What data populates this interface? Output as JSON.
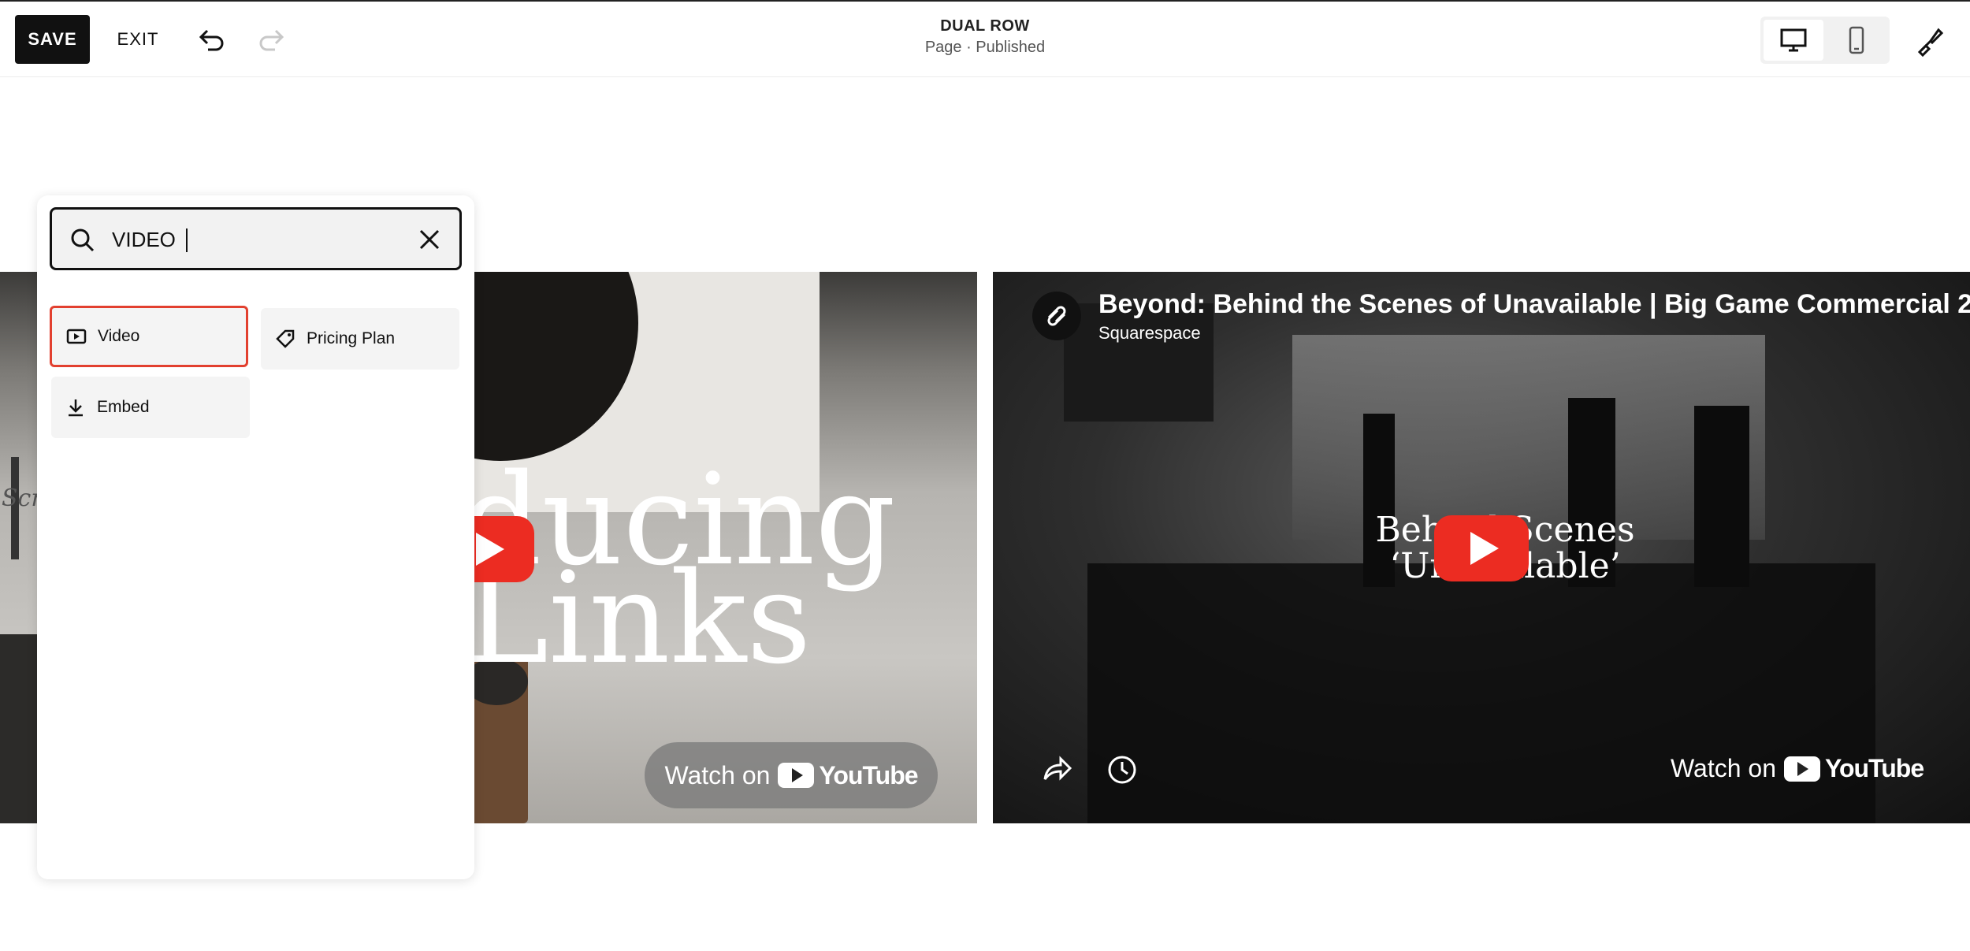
{
  "toolbar": {
    "save_label": "SAVE",
    "exit_label": "EXIT",
    "undo_icon": "undo-icon",
    "redo_icon": "redo-icon",
    "desktop_icon": "desktop-icon",
    "mobile_icon": "mobile-icon",
    "style_icon": "paintbrush-icon"
  },
  "page": {
    "title": "DUAL ROW",
    "status": "Page · Published"
  },
  "block_search": {
    "query": "VIDEO",
    "results": [
      {
        "label": "Video",
        "icon": "video-icon",
        "highlighted": true
      },
      {
        "label": "Pricing Plan",
        "icon": "tag-icon",
        "highlighted": false
      },
      {
        "label": "Embed",
        "icon": "download-icon",
        "highlighted": false
      }
    ]
  },
  "video_left": {
    "overlay_text_line1": "ducing",
    "overlay_text_line2": "Links",
    "partial_text": "Scri",
    "watch_on": "Watch on",
    "youtube": "YouTube"
  },
  "video_right": {
    "title": "Beyond: Behind the Scenes of Unavailable | Big Game Commercial 2",
    "channel": "Squarespace",
    "overlay_line1": "Behind Scenes",
    "overlay_line2": "‘Unavailable’",
    "watch_on": "Watch on",
    "youtube": "YouTube"
  },
  "colors": {
    "accent_dark": "#111111",
    "highlight_red": "#e2402f",
    "youtube_red": "#ec2c22"
  }
}
